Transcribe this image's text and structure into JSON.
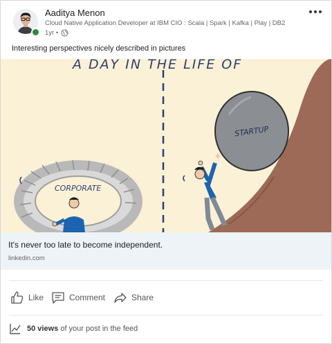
{
  "author": {
    "name": "Aaditya Menon",
    "headline": "Cloud Native Application Developer at IBM CIO : Scala | Spark | Kafka | Play | DB2",
    "time": "1yr •",
    "avatar_icon": "profile-photo"
  },
  "post": {
    "text": "Interesting perspectives nicely described in pictures"
  },
  "image": {
    "title": "A DAY IN THE LIFE OF",
    "left_label": "CORPORATE",
    "right_label": "STARTUP"
  },
  "link": {
    "title": "It's never too late to become independent.",
    "domain": "linkedin.com"
  },
  "actions": {
    "like": "Like",
    "comment": "Comment",
    "share": "Share"
  },
  "views": {
    "count": "50 views",
    "suffix": "of your post in the feed"
  },
  "colors": {
    "presence": "#2e8b3d",
    "link_box_bg": "#eef3f8",
    "illustration_bg": "#faf1d6",
    "hill": "#9c6a56",
    "shirt": "#1c63b0"
  }
}
